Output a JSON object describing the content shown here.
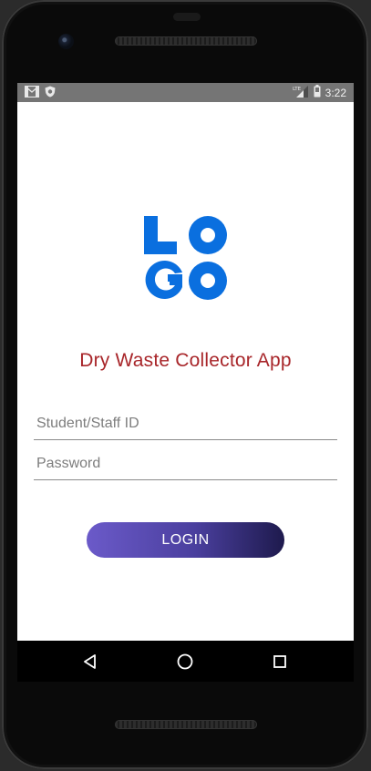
{
  "status_bar": {
    "time": "3:22",
    "left_icons": [
      "gmail-icon",
      "shield-icon"
    ],
    "right_icons": [
      "lte-signal-icon",
      "battery-icon"
    ],
    "network_label": "LTE"
  },
  "logo": {
    "text_line1": "LO",
    "text_line2": "GO",
    "color": "#0a6fdf"
  },
  "app": {
    "title": "Dry Waste Collector App"
  },
  "login_form": {
    "id_field": {
      "placeholder": "Student/Staff ID",
      "value": ""
    },
    "password_field": {
      "placeholder": "Password",
      "value": ""
    },
    "login_button_label": "LOGIN"
  },
  "nav_bar": {
    "buttons": [
      "back-icon",
      "home-icon",
      "recents-icon"
    ]
  },
  "colors": {
    "title": "#a8262a",
    "button_gradient_start": "#6b5ac9",
    "button_gradient_end": "#1e1a4d",
    "status_bar": "#757575"
  }
}
